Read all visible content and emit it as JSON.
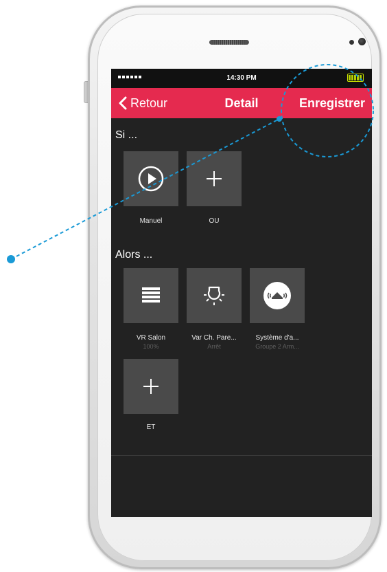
{
  "status_bar": {
    "time": "14:30 PM"
  },
  "nav": {
    "back_label": "Retour",
    "title": "Detail",
    "save_label": "Enregistrer"
  },
  "sections": {
    "if_title": "Si ...",
    "then_title": "Alors ..."
  },
  "if_tiles": [
    {
      "icon": "play-circle-icon",
      "label": "Manuel"
    },
    {
      "icon": "plus-icon",
      "label": "OU"
    }
  ],
  "then_tiles": [
    {
      "icon": "shutter-icon",
      "label": "VR Salon",
      "sub": "100%"
    },
    {
      "icon": "light-bulb-icon",
      "label": "Var Ch. Pare...",
      "sub": "Arrêt"
    },
    {
      "icon": "alarm-system-icon",
      "label": "Système d'a...",
      "sub": "Groupe 2 Arm..."
    }
  ],
  "add_tile": {
    "icon": "plus-icon",
    "label": "ET"
  },
  "colors": {
    "accent": "#e52a4f",
    "screen_bg": "#222222",
    "tile_bg": "#4a4a4a",
    "annotation": "#1a9ad6"
  }
}
